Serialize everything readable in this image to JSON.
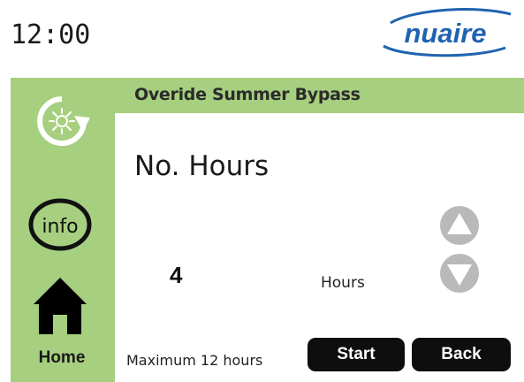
{
  "status": {
    "time": "12:00"
  },
  "brand": {
    "name": "nuaire",
    "color": "#1f63b0"
  },
  "screen": {
    "title": "Overide Summer Bypass"
  },
  "main": {
    "heading": "No. Hours",
    "value": "4",
    "unit": "Hours",
    "max_note": "Maximum 12 hours"
  },
  "sidebar": {
    "items": [
      {
        "icon": "summer-bypass-icon"
      },
      {
        "icon": "info-icon",
        "label": "info"
      },
      {
        "icon": "home-icon",
        "label": "Home"
      }
    ]
  },
  "controls": {
    "increase_icon": "up-arrow-icon",
    "decrease_icon": "down-arrow-icon",
    "start_label": "Start",
    "back_label": "Back"
  },
  "colors": {
    "accent_green": "#a6cf7f",
    "button": "#0e0e0e",
    "arrow": "#b9b9b9"
  }
}
